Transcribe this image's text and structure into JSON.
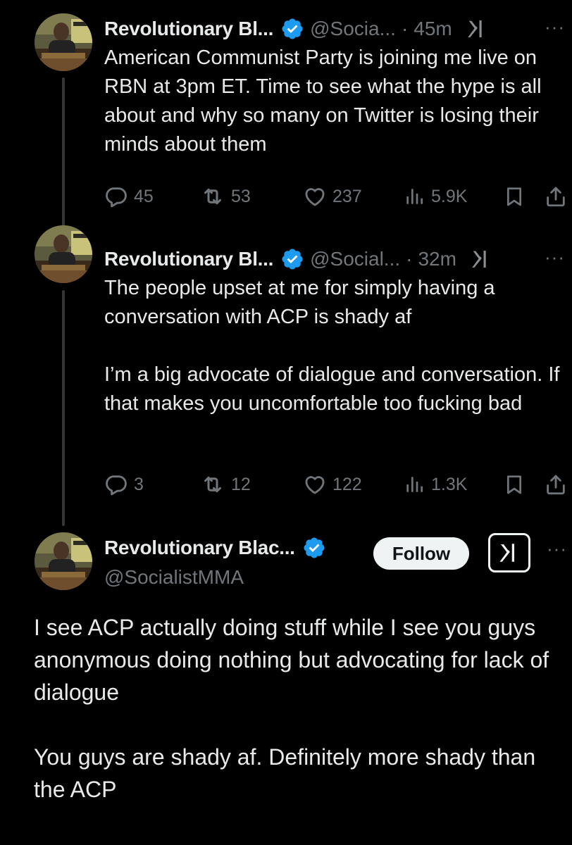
{
  "tweets": [
    {
      "name": "Revolutionary Bl...",
      "handle": "@Socia...",
      "time": "45m",
      "text": "American Communist Party is joining me live on RBN at 3pm ET. Time to see what the hype is all about and why so many on Twitter is losing their minds about them",
      "replies": "45",
      "reposts": "53",
      "likes": "237",
      "views": "5.9K"
    },
    {
      "name": "Revolutionary Bl...",
      "handle": "@Social...",
      "time": "32m",
      "text": "The people upset at me for simply having a conversation with ACP is shady af\n\nI’m a big advocate of dialogue and conversation. If that makes you uncomfortable too fucking bad",
      "replies": "3",
      "reposts": "12",
      "likes": "122",
      "views": "1.3K"
    }
  ],
  "main": {
    "name": "Revolutionary Blac...",
    "handle": "@SocialistMMA",
    "follow_label": "Follow",
    "text": "I see ACP actually doing stuff while I see you guys anonymous doing nothing but advocating for lack of dialogue\n\nYou guys are shady af. Definitely more shady than the ACP"
  },
  "separator_dot": "·",
  "more_glyph": "···",
  "colors": {
    "background": "#000000",
    "text": "#e7e9ea",
    "muted": "#71767b",
    "verified_blue": "#1d9bf0",
    "thread_line": "#333639"
  },
  "icons": [
    "verified-badge-icon",
    "grok-icon",
    "more-icon",
    "reply-icon",
    "repost-icon",
    "like-icon",
    "views-icon",
    "bookmark-icon",
    "share-icon"
  ]
}
